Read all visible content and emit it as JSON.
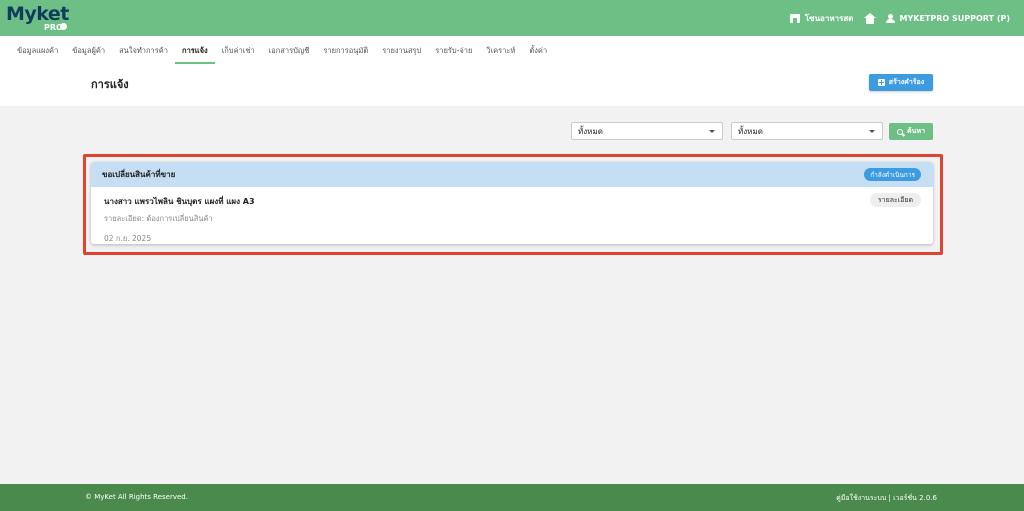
{
  "brand": {
    "name": "Myket",
    "sub": "PRO"
  },
  "topbar": {
    "shop_label": "โซนอาหารสด",
    "user_label": "MYKETPRO SUPPORT (P)"
  },
  "nav": {
    "items": [
      {
        "label": "ข้อมูลแผงค้า"
      },
      {
        "label": "ข้อมูลผู้ค้า"
      },
      {
        "label": "สนใจทำการค้า"
      },
      {
        "label": "การแจ้ง"
      },
      {
        "label": "เก็บค่าเช่า"
      },
      {
        "label": "เอกสารบัญชี"
      },
      {
        "label": "รายการอนุมัติ"
      },
      {
        "label": "รายงานสรุป"
      },
      {
        "label": "รายรับ-จ่าย"
      },
      {
        "label": "วิเคราะห์"
      },
      {
        "label": "ตั้งค่า"
      }
    ],
    "active_index": 3
  },
  "page": {
    "title": "การแจ้ง",
    "create_label": "สร้างคำร้อง"
  },
  "filters": {
    "select1_value": "ทั้งหมด",
    "select2_value": "ทั้งหมด",
    "search_label": "ค้นหา"
  },
  "card": {
    "title": "ขอเปลี่ยนสินค้าที่ขาย",
    "status": "กำลังดำเนินการ",
    "name": "นางสาว แพรวไพลิน ชินบุตร แผงที่ แผง A3",
    "detail": "รายละเอียด: ต้องการเปลี่ยนสินค้า",
    "date": "02 ก.ย. 2025",
    "detail_button": "รายละเอียด"
  },
  "footer": {
    "copyright": "© MyKet All Rights Reserved.",
    "right": "คู่มือใช้งานระบบ | เวอร์ชั่น 2.0.6"
  },
  "colors": {
    "topbar": "#6dbf86",
    "footer": "#4a8a4c",
    "primary_blue": "#3d9be0",
    "highlight_red": "#e0432f",
    "card_header": "#c6def3"
  }
}
